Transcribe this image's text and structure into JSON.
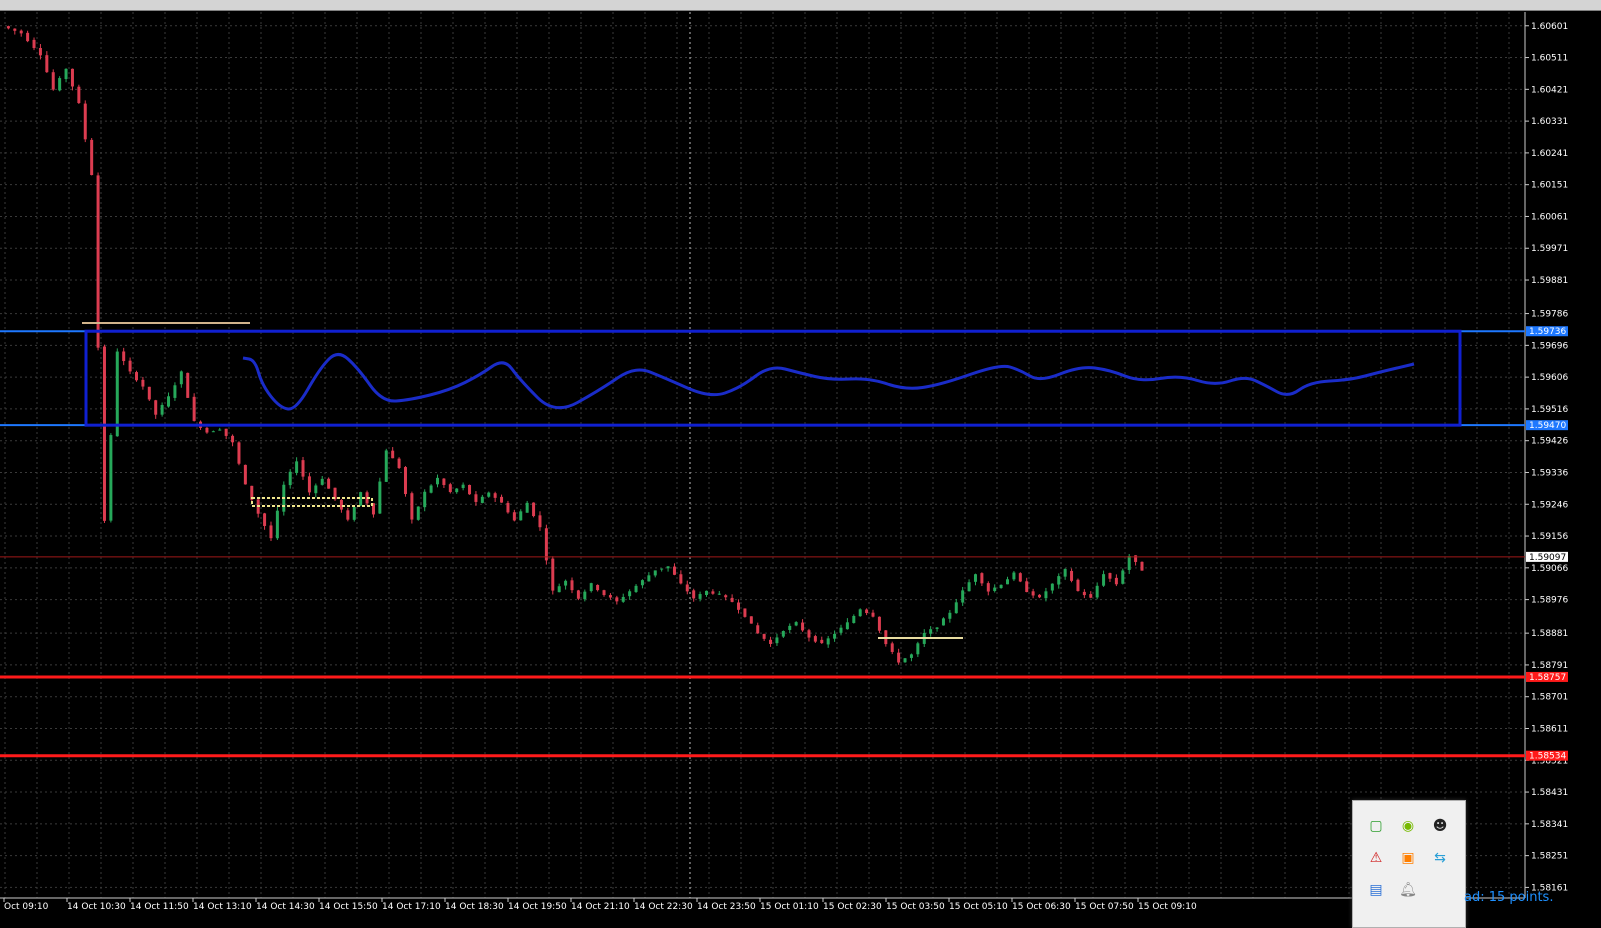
{
  "chart_data": {
    "type": "candlestick",
    "price_axis": [
      "1.60601",
      "1.60511",
      "1.60421",
      "1.60331",
      "1.60241",
      "1.60151",
      "1.60061",
      "1.59971",
      "1.59881",
      "1.59786",
      "1.59696",
      "1.59606",
      "1.59516",
      "1.59426",
      "1.59336",
      "1.59246",
      "1.59156",
      "1.59066",
      "1.58976",
      "1.58881",
      "1.58791",
      "1.58701",
      "1.58611",
      "1.58521",
      "1.58431",
      "1.58341",
      "1.58251",
      "1.58161"
    ],
    "time_axis": [
      "Oct 09:10",
      "14 Oct 10:30",
      "14 Oct 11:50",
      "14 Oct 13:10",
      "14 Oct 14:30",
      "14 Oct 15:50",
      "14 Oct 17:10",
      "14 Oct 18:30",
      "14 Oct 19:50",
      "14 Oct 21:10",
      "14 Oct 22:30",
      "14 Oct 23:50",
      "15 Oct 01:10",
      "15 Oct 02:30",
      "15 Oct 03:50",
      "15 Oct 05:10",
      "15 Oct 06:30",
      "15 Oct 07:50",
      "15 Oct 09:10"
    ],
    "close_path": [
      [
        0,
        1.606
      ],
      [
        3,
        1.6058
      ],
      [
        6,
        1.6052
      ],
      [
        8,
        1.6042
      ],
      [
        10,
        1.6048
      ],
      [
        12,
        1.6038
      ],
      [
        14,
        1.6018
      ],
      [
        16,
        1.592
      ],
      [
        18,
        1.5968
      ],
      [
        20,
        1.5962
      ],
      [
        22,
        1.5958
      ],
      [
        24,
        1.595
      ],
      [
        26,
        1.5955
      ],
      [
        28,
        1.5962
      ],
      [
        30,
        1.5948
      ],
      [
        32,
        1.5945
      ],
      [
        34,
        1.5946
      ],
      [
        36,
        1.5942
      ],
      [
        38,
        1.593
      ],
      [
        40,
        1.5922
      ],
      [
        42,
        1.5915
      ],
      [
        44,
        1.593
      ],
      [
        46,
        1.5937
      ],
      [
        48,
        1.5928
      ],
      [
        50,
        1.5932
      ],
      [
        52,
        1.5926
      ],
      [
        54,
        1.592
      ],
      [
        56,
        1.5928
      ],
      [
        58,
        1.5922
      ],
      [
        60,
        1.594
      ],
      [
        62,
        1.5935
      ],
      [
        64,
        1.592
      ],
      [
        66,
        1.5928
      ],
      [
        68,
        1.5932
      ],
      [
        70,
        1.5928
      ],
      [
        72,
        1.593
      ],
      [
        74,
        1.5925
      ],
      [
        76,
        1.5928
      ],
      [
        78,
        1.5925
      ],
      [
        80,
        1.592
      ],
      [
        82,
        1.5925
      ],
      [
        84,
        1.5918
      ],
      [
        86,
        1.59
      ],
      [
        88,
        1.5903
      ],
      [
        90,
        1.5898
      ],
      [
        92,
        1.5902
      ],
      [
        94,
        1.5899
      ],
      [
        96,
        1.5897
      ],
      [
        98,
        1.59
      ],
      [
        100,
        1.5903
      ],
      [
        102,
        1.5906
      ],
      [
        104,
        1.5907
      ],
      [
        106,
        1.5902
      ],
      [
        108,
        1.5898
      ],
      [
        110,
        1.59
      ],
      [
        112,
        1.5899
      ],
      [
        114,
        1.5897
      ],
      [
        116,
        1.5893
      ],
      [
        118,
        1.5888
      ],
      [
        120,
        1.5885
      ],
      [
        122,
        1.5889
      ],
      [
        124,
        1.5891
      ],
      [
        126,
        1.5887
      ],
      [
        128,
        1.5885
      ],
      [
        130,
        1.5888
      ],
      [
        132,
        1.5891
      ],
      [
        134,
        1.5895
      ],
      [
        136,
        1.5893
      ],
      [
        138,
        1.5885
      ],
      [
        140,
        1.588
      ],
      [
        142,
        1.5882
      ],
      [
        144,
        1.5888
      ],
      [
        146,
        1.589
      ],
      [
        148,
        1.5894
      ],
      [
        150,
        1.59
      ],
      [
        152,
        1.5905
      ],
      [
        154,
        1.59
      ],
      [
        156,
        1.5902
      ],
      [
        158,
        1.5905
      ],
      [
        160,
        1.59
      ],
      [
        162,
        1.5898
      ],
      [
        164,
        1.5902
      ],
      [
        166,
        1.5906
      ],
      [
        168,
        1.59
      ],
      [
        170,
        1.5898
      ],
      [
        172,
        1.5905
      ],
      [
        174,
        1.5902
      ],
      [
        176,
        1.591
      ],
      [
        178,
        1.5906
      ]
    ],
    "horizontal_lines": [
      {
        "price": 1.59736,
        "label": "1.59736",
        "color": "#1e78ff"
      },
      {
        "price": 1.5947,
        "label": "1.59470",
        "color": "#1e78ff"
      },
      {
        "price": 1.59097,
        "label": "1.59097",
        "color": "#a01818"
      },
      {
        "price": 1.58757,
        "label": "1.58757",
        "color": "#ff1a1a"
      },
      {
        "price": 1.58534,
        "label": "1.58534",
        "color": "#ff1a1a"
      }
    ],
    "colors": {
      "bull": "#26a85a",
      "bear": "#dc3c50",
      "grid": "#3a3a3a",
      "rect": "#1020d0",
      "curve": "#1a2cc8",
      "yellow": "#f0e68c"
    }
  },
  "tray": {
    "icons": [
      "evernote-icon",
      "nvidia-icon",
      "user-icon",
      "warning-app-icon",
      "sublime-icon",
      "network-icon",
      "computer-icon",
      "bell-icon"
    ],
    "spread_text": "ad: 15 points."
  }
}
